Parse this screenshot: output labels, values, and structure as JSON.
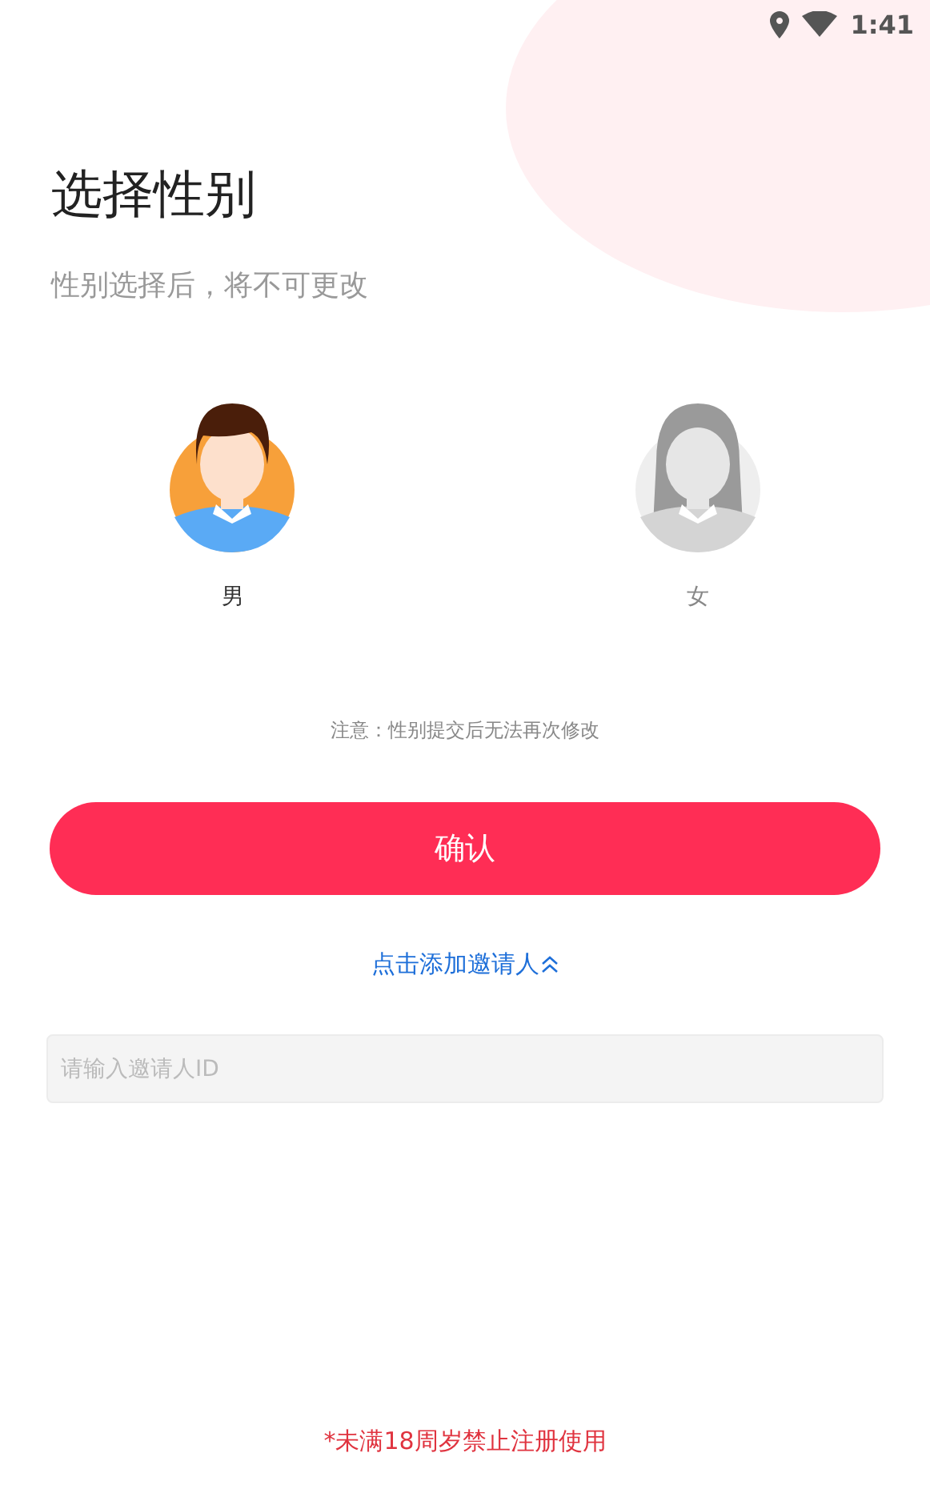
{
  "status_bar": {
    "time": "1:41"
  },
  "title": "选择性别",
  "subtitle": "性别选择后，将不可更改",
  "genders": [
    {
      "kind": "male",
      "label": "男",
      "selected": true
    },
    {
      "kind": "female",
      "label": "女",
      "selected": false
    }
  ],
  "notice": "注意：性别提交后无法再次修改",
  "confirm_button": "确认",
  "inviter_link": "点击添加邀请人",
  "inviter_link_expanded": true,
  "inviter_field": {
    "placeholder": "请输入邀请人ID"
  },
  "footer_warning": "*未满18周岁禁止注册使用"
}
